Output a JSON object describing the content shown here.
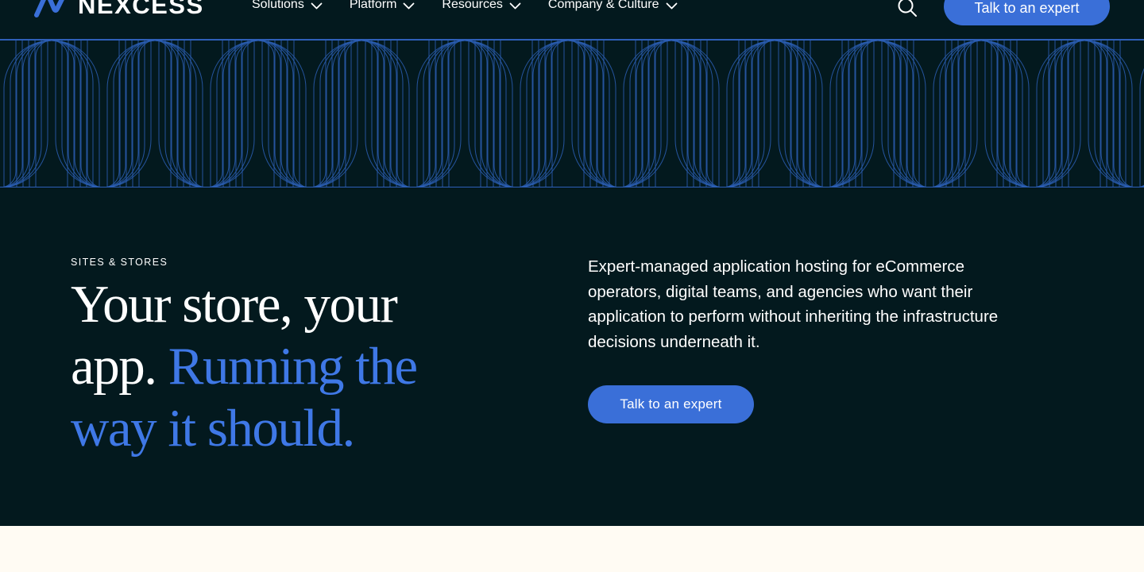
{
  "brand": {
    "name": "NEXCESS",
    "logo_icon": "nexcess-logo-icon",
    "accent_color": "#3a6fd8",
    "background_color": "#03191e",
    "cream_color": "#fffbf3"
  },
  "nav": {
    "items": [
      {
        "label": "Solutions",
        "icon": "chevron-down-icon"
      },
      {
        "label": "Platform",
        "icon": "chevron-down-icon"
      },
      {
        "label": "Resources",
        "icon": "chevron-down-icon"
      },
      {
        "label": "Company & Culture",
        "icon": "chevron-down-icon"
      }
    ],
    "search_icon": "search-icon",
    "cta_label": "Talk to an expert"
  },
  "hero": {
    "eyebrow": "SITES & STORES",
    "headline_white": "Your store, your app.",
    "headline_blue": "Running the way it should.",
    "description": "Expert-managed application hosting for eCommerce operators, digital teams, and agencies who want their application to perform without inheriting the infrastructure decisions underneath it.",
    "cta_label": "Talk to an expert"
  }
}
